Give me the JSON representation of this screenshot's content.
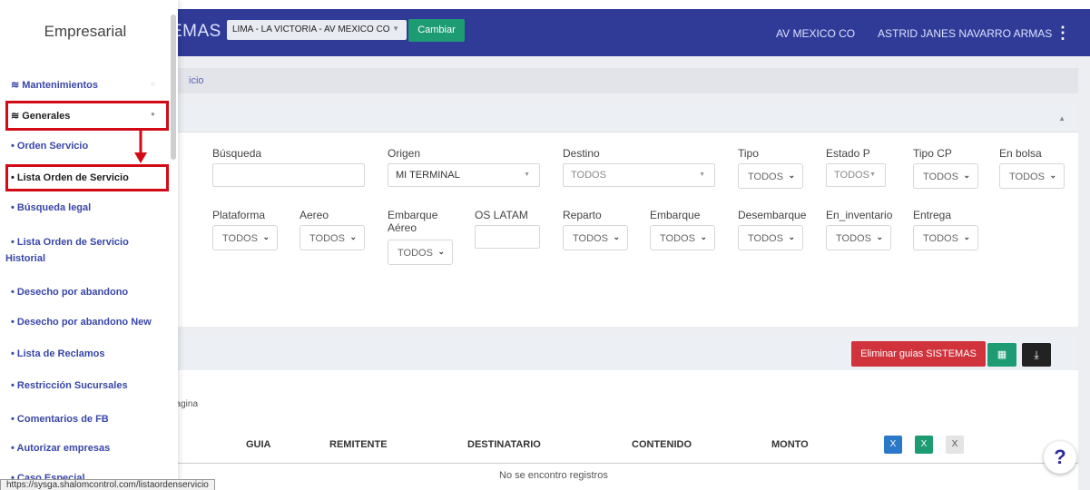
{
  "app": {
    "brand_suffix": "EMAS",
    "branch_value": "LIMA - LA VICTORIA - AV MEXICO CO",
    "change_label": "Cambiar",
    "office": "AV MEXICO CO",
    "user": "ASTRID JANES NAVARRO ARMAS",
    "menu_icon": "kebab-vertical-icon"
  },
  "breadcrumb": {
    "text": "icio"
  },
  "filters": {
    "busqueda": {
      "label": "Búsqueda",
      "value": ""
    },
    "origen": {
      "label": "Origen",
      "value": "MI TERMINAL"
    },
    "destino": {
      "label": "Destino",
      "value": "TODOS"
    },
    "tipo": {
      "label": "Tipo",
      "value": "TODOS"
    },
    "estado_p": {
      "label": "Estado P",
      "value": "TODOS"
    },
    "tipo_cp": {
      "label": "Tipo CP",
      "value": "TODOS"
    },
    "en_bolsa": {
      "label": "En bolsa",
      "value": "TODOS"
    },
    "plataforma": {
      "label": "Plataforma",
      "value": "TODOS"
    },
    "aereo": {
      "label": "Aereo",
      "value": "TODOS"
    },
    "embarque_aereo": {
      "label_line1": "Embarque",
      "label_line2": "Aéreo",
      "value": "TODOS"
    },
    "os_latam": {
      "label": "OS LATAM",
      "value": ""
    },
    "reparto": {
      "label": "Reparto",
      "value": "TODOS"
    },
    "embarque": {
      "label": "Embarque",
      "value": "TODOS"
    },
    "desembarque": {
      "label": "Desembarque",
      "value": "TODOS"
    },
    "en_inventario": {
      "label": "En_inventario",
      "value": "TODOS"
    },
    "entrega": {
      "label": "Entrega",
      "value": "TODOS"
    }
  },
  "results": {
    "delete_label": "Eliminar guias SISTEMAS",
    "per_page_text": "pagina",
    "columns": [
      "GUIA",
      "REMITENTE",
      "DESTINATARIO",
      "CONTENIDO",
      "MONTO"
    ],
    "empty_text": "No se encontro registros"
  },
  "sidebar": {
    "title": "Empresarial",
    "sections": [
      {
        "label": "Mantenimientos"
      },
      {
        "label": "Generales"
      }
    ],
    "items": [
      {
        "label": "• Orden Servicio"
      },
      {
        "label": "• Lista Orden de Servicio"
      },
      {
        "label": "• Búsqueda legal"
      },
      {
        "label": "• Lista Orden de Servicio"
      },
      {
        "label": "Historial"
      },
      {
        "label": "• Desecho por abandono"
      },
      {
        "label": "• Desecho por abandono New"
      },
      {
        "label": "• Lista de Reclamos"
      },
      {
        "label": "• Restricción Sucursales"
      },
      {
        "label": "• Comentarios de FB"
      },
      {
        "label": "• Autorizar empresas"
      },
      {
        "label": "• Caso Especial"
      }
    ]
  },
  "status_url": "https://sysga.shalomcontrol.com/listaordenservicio",
  "colors": {
    "navbar": "#2f3b97",
    "accent_green": "#1d9c73",
    "danger": "#d0333c",
    "highlight": "#d10a16"
  }
}
